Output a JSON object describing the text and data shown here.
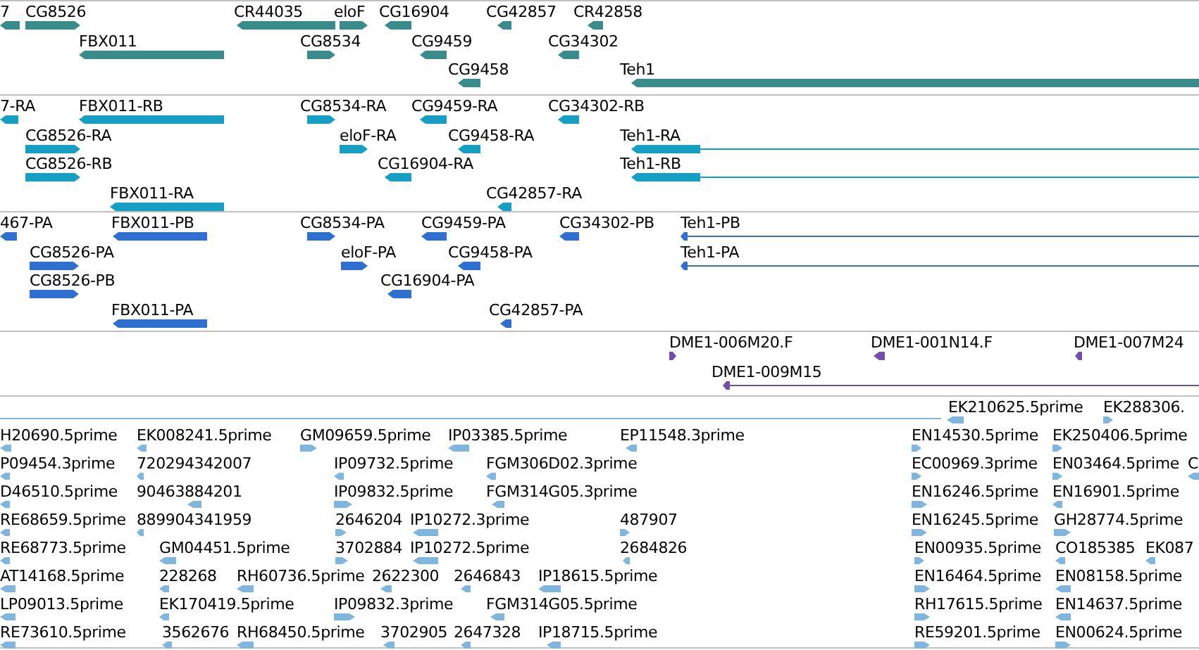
{
  "tracks": [
    {
      "kind": "gene",
      "color": "#3a8c8c",
      "features": [
        {
          "label": "7",
          "reverse": true
        },
        {
          "label": "CG8526",
          "reverse": false
        },
        {
          "label": "CR44035",
          "reverse": true
        },
        {
          "label": "eloF",
          "reverse": false
        },
        {
          "label": "CG16904",
          "reverse": true
        },
        {
          "label": "CG42857",
          "reverse": true
        },
        {
          "label": "CR42858",
          "reverse": true
        },
        {
          "label": "FBX011",
          "reverse": true
        },
        {
          "label": "CG8534",
          "reverse": false
        },
        {
          "label": "CG9459",
          "reverse": true
        },
        {
          "label": "CG34302",
          "reverse": true
        },
        {
          "label": "CG9458",
          "reverse": true
        },
        {
          "label": "Teh1",
          "reverse": true
        }
      ]
    },
    {
      "kind": "transcript",
      "color": "#169fc2",
      "features": [
        {
          "label": "7-RA",
          "reverse": true
        },
        {
          "label": "FBX011-RB",
          "reverse": true
        },
        {
          "label": "CG8534-RA",
          "reverse": false
        },
        {
          "label": "CG9459-RA",
          "reverse": true
        },
        {
          "label": "CG34302-RB",
          "reverse": true
        },
        {
          "label": "CG8526-RA",
          "reverse": false
        },
        {
          "label": "eloF-RA",
          "reverse": false
        },
        {
          "label": "CG9458-RA",
          "reverse": true
        },
        {
          "label": "Teh1-RA",
          "reverse": true
        },
        {
          "label": "CG8526-RB",
          "reverse": false
        },
        {
          "label": "CG16904-RA",
          "reverse": true
        },
        {
          "label": "Teh1-RB",
          "reverse": true
        },
        {
          "label": "FBX011-RA",
          "reverse": true
        },
        {
          "label": "CG42857-RA",
          "reverse": true
        }
      ]
    },
    {
      "kind": "transcript",
      "color": "#2f6fd0",
      "features": [
        {
          "label": "467-PA",
          "reverse": true
        },
        {
          "label": "FBX011-PB",
          "reverse": true
        },
        {
          "label": "CG8534-PA",
          "reverse": false
        },
        {
          "label": "CG9459-PA",
          "reverse": true
        },
        {
          "label": "CG34302-PB",
          "reverse": true
        },
        {
          "label": "Teh1-PB",
          "reverse": true
        },
        {
          "label": "CG8526-PA",
          "reverse": false
        },
        {
          "label": "eloF-PA",
          "reverse": false
        },
        {
          "label": "CG9458-PA",
          "reverse": true
        },
        {
          "label": "Teh1-PA",
          "reverse": true
        },
        {
          "label": "CG8526-PB",
          "reverse": false
        },
        {
          "label": "CG16904-PA",
          "reverse": true
        },
        {
          "label": "FBX011-PA",
          "reverse": true
        },
        {
          "label": "CG42857-PA",
          "reverse": true
        }
      ]
    },
    {
      "kind": "clone",
      "color": "#7050a8",
      "features": [
        {
          "label": "DME1-006M20.F",
          "reverse": false
        },
        {
          "label": "DME1-001N14.F",
          "reverse": true
        },
        {
          "label": "DME1-007M24",
          "reverse": true
        },
        {
          "label": "DME1-009M15",
          "reverse": true
        }
      ]
    },
    {
      "kind": "est",
      "color": "#80b6de",
      "features": [
        {
          "label": "EK210625.5prime",
          "reverse": true
        },
        {
          "label": "EK288306.",
          "reverse": false
        },
        {
          "label": "H20690.5prime",
          "reverse": true
        },
        {
          "label": "EK008241.5prime",
          "reverse": true
        },
        {
          "label": "GM09659.5prime",
          "reverse": false
        },
        {
          "label": "IP03385.5prime",
          "reverse": true
        },
        {
          "label": "EP11548.3prime",
          "reverse": true
        },
        {
          "label": "EN14530.5prime",
          "reverse": false
        },
        {
          "label": "EK250406.5prime",
          "reverse": false
        },
        {
          "label": "P09454.3prime",
          "reverse": true
        },
        {
          "label": "720294342007",
          "reverse": true
        },
        {
          "label": "IP09732.5prime",
          "reverse": true
        },
        {
          "label": "FGM306D02.3prime",
          "reverse": true
        },
        {
          "label": "EC00969.3prime",
          "reverse": false
        },
        {
          "label": "EN03464.5prime",
          "reverse": false
        },
        {
          "label": "C",
          "reverse": true
        },
        {
          "label": "D46510.5prime",
          "reverse": true
        },
        {
          "label": "90463884201",
          "reverse": true
        },
        {
          "label": "IP09832.5prime",
          "reverse": false
        },
        {
          "label": "FGM314G05.3prime",
          "reverse": true
        },
        {
          "label": "EN16246.5prime",
          "reverse": false
        },
        {
          "label": "EN16901.5prime",
          "reverse": true
        },
        {
          "label": "RE68659.5prime",
          "reverse": true
        },
        {
          "label": "889904341959",
          "reverse": true
        },
        {
          "label": "2646204",
          "reverse": false
        },
        {
          "label": "IP10272.3prime",
          "reverse": true
        },
        {
          "label": "487907",
          "reverse": false
        },
        {
          "label": "EN16245.5prime",
          "reverse": false
        },
        {
          "label": "GH28774.5prime",
          "reverse": false
        },
        {
          "label": "RE68773.5prime",
          "reverse": true
        },
        {
          "label": "GM04451.5prime",
          "reverse": true
        },
        {
          "label": "3702884",
          "reverse": false
        },
        {
          "label": "IP10272.5prime",
          "reverse": true
        },
        {
          "label": "2684826",
          "reverse": true
        },
        {
          "label": "EN00935.5prime",
          "reverse": false
        },
        {
          "label": "CO185385",
          "reverse": true
        },
        {
          "label": "EK087",
          "reverse": true
        },
        {
          "label": "AT14168.5prime",
          "reverse": true
        },
        {
          "label": "228268",
          "reverse": true
        },
        {
          "label": "RH60736.5prime",
          "reverse": true
        },
        {
          "label": "2622300",
          "reverse": true
        },
        {
          "label": "2646843",
          "reverse": true
        },
        {
          "label": "IP18615.5prime",
          "reverse": true
        },
        {
          "label": "EN16464.5prime",
          "reverse": false
        },
        {
          "label": "EN08158.5prime",
          "reverse": true
        },
        {
          "label": "LP09013.5prime",
          "reverse": true
        },
        {
          "label": "EK170419.5prime",
          "reverse": true
        },
        {
          "label": "IP09832.3prime",
          "reverse": false
        },
        {
          "label": "FGM314G05.5prime",
          "reverse": true
        },
        {
          "label": "RH17615.5prime",
          "reverse": false
        },
        {
          "label": "EN14637.5prime",
          "reverse": true
        },
        {
          "label": "RE73610.5prime",
          "reverse": true
        },
        {
          "label": "3562676",
          "reverse": true
        },
        {
          "label": "RH68450.5prime",
          "reverse": true
        },
        {
          "label": "3702905",
          "reverse": true
        },
        {
          "label": "2647328",
          "reverse": true
        },
        {
          "label": "IP18715.5prime",
          "reverse": true
        },
        {
          "label": "RE59201.5prime",
          "reverse": false
        },
        {
          "label": "EN00624.5prime",
          "reverse": false
        }
      ]
    }
  ]
}
